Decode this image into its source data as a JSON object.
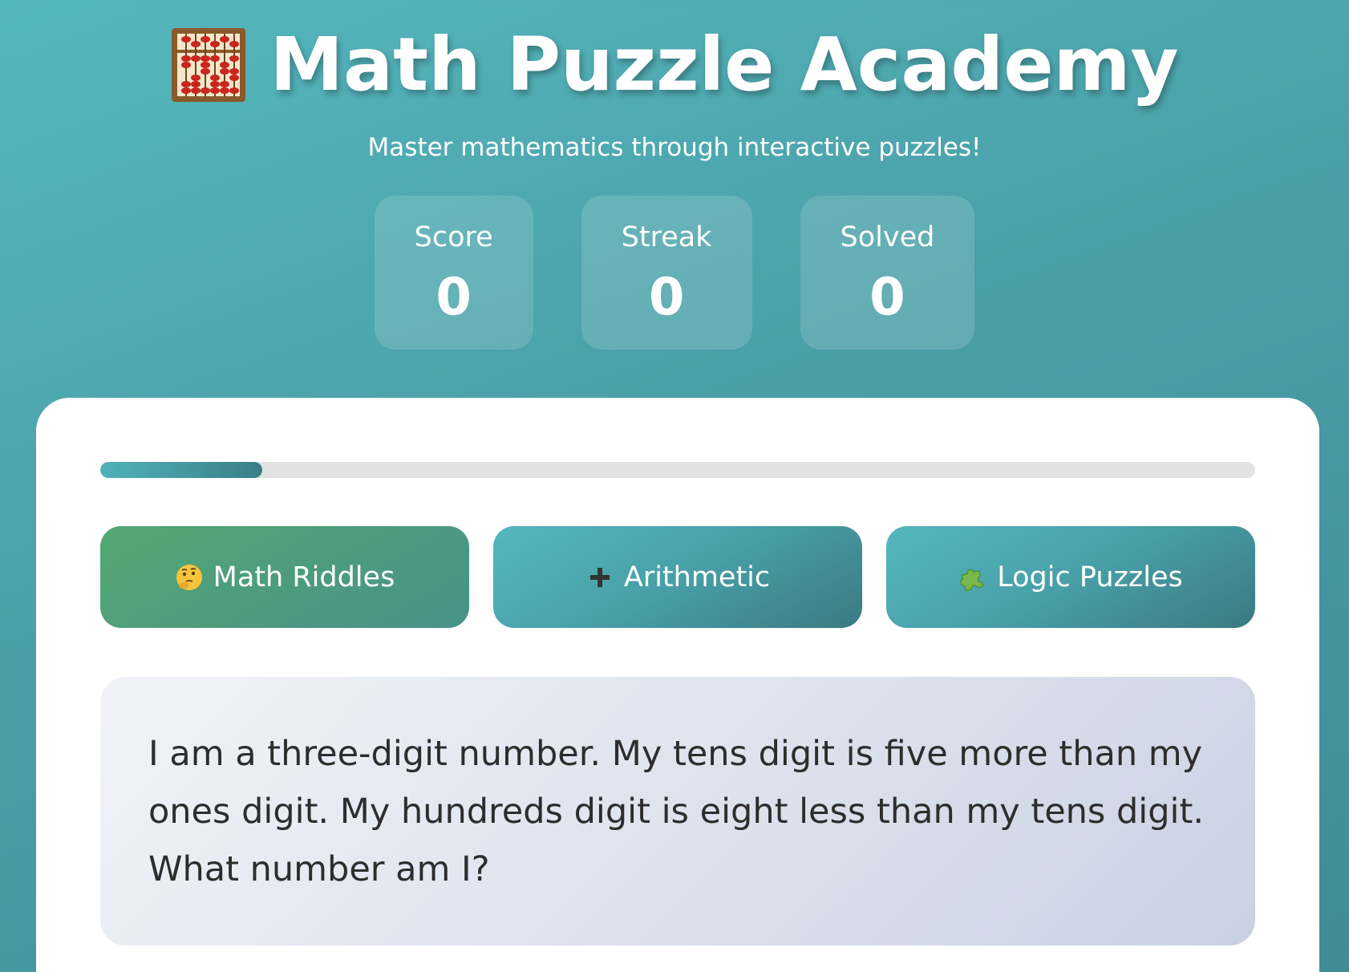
{
  "header": {
    "title": "Math Puzzle Academy",
    "title_icon": "abacus-icon",
    "subtitle": "Master mathematics through interactive puzzles!"
  },
  "stats": [
    {
      "label": "Score",
      "value": "0"
    },
    {
      "label": "Streak",
      "value": "0"
    },
    {
      "label": "Solved",
      "value": "0"
    }
  ],
  "progress": {
    "fraction": 0.14
  },
  "tabs": [
    {
      "label": "Math Riddles",
      "icon": "thinking-face-icon",
      "active": true
    },
    {
      "label": "Arithmetic",
      "icon": "plus-icon",
      "active": false
    },
    {
      "label": "Logic Puzzles",
      "icon": "puzzle-piece-icon",
      "active": false
    }
  ],
  "puzzle": {
    "text": "I am a three-digit number. My tens digit is five more than my ones digit. My hundreds digit is eight less than my tens digit. What number am I?"
  },
  "colors": {
    "background": "#4a9fa7",
    "accent": "#4fb2b9",
    "active_tab": "#54a873",
    "text_dark": "#2d2d2d"
  }
}
